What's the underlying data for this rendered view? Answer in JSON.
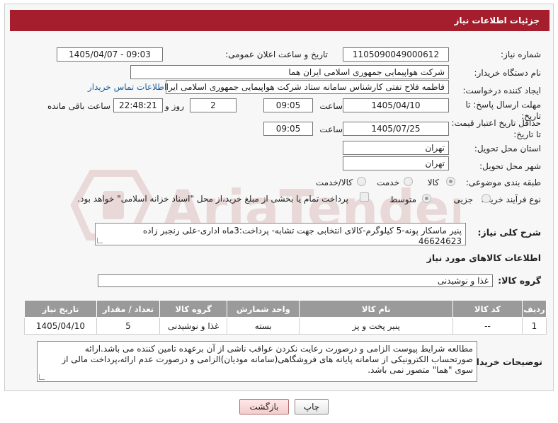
{
  "header": {
    "title": "جزئیات اطلاعات نیاز"
  },
  "form": {
    "need_number_label": "شماره نیاز:",
    "need_number": "1105090049000612",
    "announce_label": "تاریخ و ساعت اعلان عمومی:",
    "announce_value": "1405/04/07 - 09:03",
    "buyer_org_label": "نام دستگاه خریدار:",
    "buyer_org": "شرکت هواپیمایی جمهوری اسلامی ایران هما",
    "requester_label": "ایجاد کننده درخواست:",
    "requester": "فاطمه فلاح تفتی کارشناس سامانه ستاد شرکت هواپیمایی جمهوری اسلامی ایران هما",
    "contact_link": "اطلاعات تماس خریدار",
    "reply_deadline_label": "مهلت ارسال پاسخ: تا تاریخ:",
    "reply_date": "1405/04/10",
    "time_label": "ساعت",
    "reply_time": "09:05",
    "days_value": "2",
    "days_label": "روز و",
    "remaining_time": "22:48:21",
    "remaining_label": "ساعت باقی مانده",
    "price_validity_label": "حداقل تاریخ اعتبار قیمت: تا تاریخ:",
    "price_date": "1405/07/25",
    "price_time_label": "ساعت",
    "price_time": "09:05",
    "province_label": "استان محل تحویل:",
    "province": "تهران",
    "city_label": "شهر محل تحویل:",
    "city": "تهران",
    "category_label": "طبقه بندی موضوعی:",
    "category_options": [
      "کالا",
      "خدمت",
      "کالا/خدمت"
    ],
    "process_label": "نوع فرآیند خرید :",
    "process_options": [
      "جزیی",
      "متوسط"
    ],
    "payment_note": "پرداخت تمام یا بخشی از مبلغ خرید،از محل \"اسناد خزانه اسلامی\" خواهد بود."
  },
  "description": {
    "label": "شرح کلی نیاز:",
    "text": "پنیر ماسکار پونه-5 کیلوگرم-کالای انتخابی جهت تشابه- پرداخت:3ماه اداری-علی رنجبر زاده 46624623"
  },
  "goods": {
    "section_title": "اطلاعات کالاهای مورد نیاز",
    "group_label": "گروه کالا:",
    "group_value": "غذا و نوشیدنی",
    "columns": [
      "ردیف",
      "کد کالا",
      "نام کالا",
      "واحد شمارش",
      "گروه کالا",
      "تعداد / مقدار",
      "تاریخ نیاز"
    ],
    "rows": [
      [
        "1",
        "--",
        "پنیر پخت و پز",
        "بسته",
        "غذا و نوشیدنی",
        "5",
        "1405/04/10"
      ]
    ]
  },
  "notes": {
    "label": "توضیحات خریدار:",
    "text": "مطالعه شرایط پیوست الزامی و درصورت رعایت نکردن عواقب ناشی از آن برعهده تامین کننده می باشد.ارائه صورتحساب الکترونیکی از سامانه پایانه های فروشگاهی(سامانه مودیان)الزامی و درصورت عدم ارائه،پرداخت مالی از سوی \"هما\" متصور نمی باشد."
  },
  "buttons": {
    "print": "چاپ",
    "back": "بازگشت"
  },
  "colors": {
    "title_bar": "#a51e2d",
    "table_header": "#9a9a9a",
    "link": "#1a5fa0",
    "watermark": "#e3c9c9"
  }
}
